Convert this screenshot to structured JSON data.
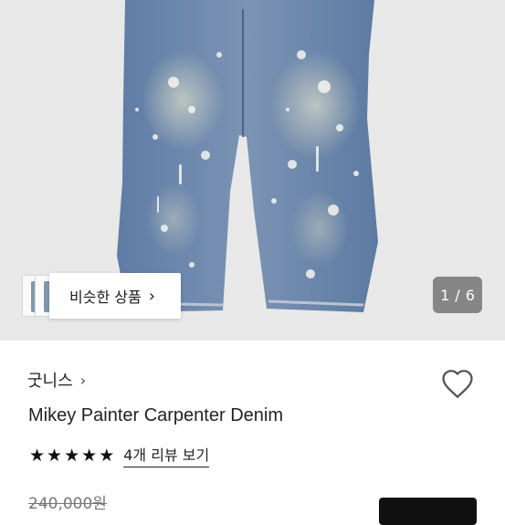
{
  "gallery": {
    "similar_label": "비슷한 상품",
    "counter_current": "1",
    "counter_separator": "/",
    "counter_total": "6",
    "background": "#e8e8e8",
    "denim_color": "#6e88ad"
  },
  "product": {
    "shop_name": "굿니스",
    "title": "Mikey Painter Carpenter Denim",
    "rating_stars": 5,
    "reviews_link": "4개 리뷰 보기",
    "original_price": "240,000원"
  },
  "icons": {
    "shop_chevron": "chevron-right-icon",
    "favorite": "heart-outline-icon",
    "star": "star-filled-icon"
  }
}
